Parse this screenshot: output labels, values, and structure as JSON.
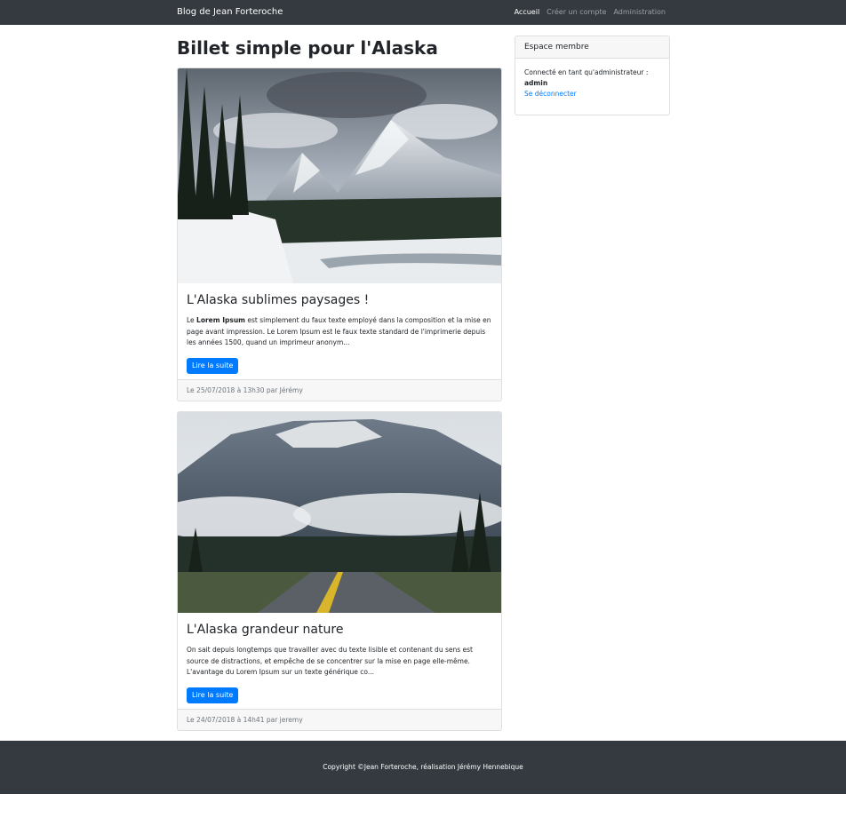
{
  "navbar": {
    "brand": "Blog de Jean Forteroche",
    "links": [
      "Accueil",
      "Créer un compte",
      "Administration"
    ]
  },
  "main": {
    "title": "Billet simple pour l'Alaska",
    "posts": [
      {
        "title": "L'Alaska sublimes paysages !",
        "excerpt_prefix": "Le ",
        "excerpt_bold": "Lorem Ipsum",
        "excerpt_rest": " est simplement du faux texte employé dans la composition et la mise en page avant impression. Le Lorem Ipsum est le faux texte standard de l'imprimerie depuis les années 1500, quand un imprimeur anonym...",
        "button": "Lire la suite",
        "footer": "Le 25/07/2018 à 13h30 par Jérémy"
      },
      {
        "title": "L'Alaska grandeur nature",
        "excerpt": "On sait depuis longtemps que travailler avec du texte lisible et contenant du sens est source de distractions, et empêche de se concentrer sur la mise en page elle-même. L'avantage du Lorem Ipsum sur un texte générique co...",
        "button": "Lire la suite",
        "footer": "Le 24/07/2018 à 14h41 par jeremy"
      }
    ]
  },
  "sidebar": {
    "header": "Espace membre",
    "status": "Connecté en tant qu'administrateur :",
    "username": "admin",
    "logout": "Se déconnecter"
  },
  "footer": {
    "text": "Copyright ©Jean Forteroche, réalisation Jérémy Hennebique"
  },
  "colors": {
    "navbar": "#343a40",
    "primary": "#007bff",
    "card_footer": "#f7f7f7"
  }
}
